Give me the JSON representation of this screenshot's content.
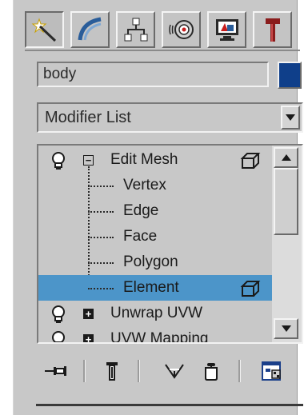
{
  "command_panel": {
    "tabs": [
      {
        "icon": "create-icon",
        "active": true
      },
      {
        "icon": "modify-icon",
        "active": false
      },
      {
        "icon": "hierarchy-icon",
        "active": false
      },
      {
        "icon": "motion-icon",
        "active": false
      },
      {
        "icon": "display-icon",
        "active": false
      },
      {
        "icon": "utilities-icon",
        "active": false
      }
    ],
    "object_name": "body",
    "object_color": "#0f3f8a",
    "modifier_list": {
      "selected": "Modifier List"
    },
    "stack": {
      "items": [
        {
          "label": "Edit Mesh",
          "expanded": true
        },
        {
          "label": "Vertex"
        },
        {
          "label": "Edge"
        },
        {
          "label": "Face"
        },
        {
          "label": "Polygon"
        },
        {
          "label": "Element",
          "selected": true
        },
        {
          "label": "Unwrap UVW",
          "expanded": false
        },
        {
          "label": "UVW Mapping",
          "expanded": false
        }
      ],
      "selection_color": "#4c95c9"
    },
    "toolbar": [
      "pin-stack-icon",
      "show-end-result-icon",
      "make-unique-icon",
      "remove-modifier-icon",
      "configure-modifier-sets-icon"
    ]
  }
}
